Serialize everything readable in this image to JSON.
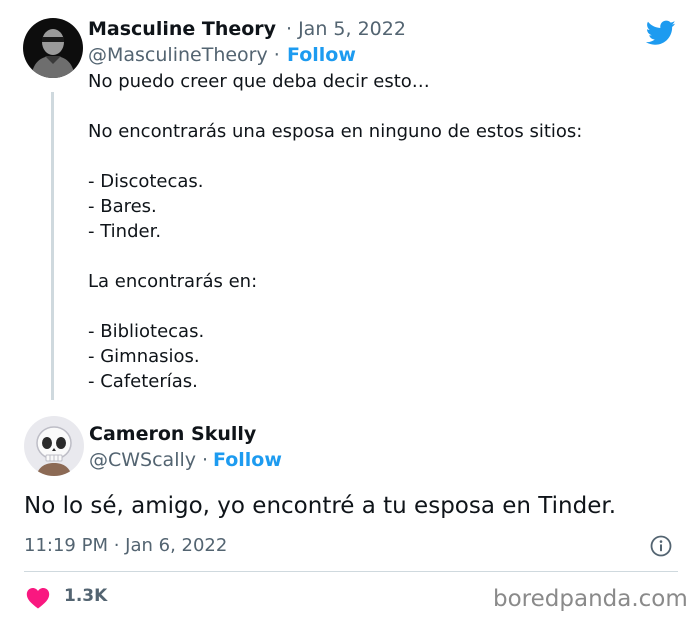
{
  "original_tweet": {
    "author_name": "Masculine Theory",
    "date": "· Jan 5, 2022",
    "handle": "@MasculineTheory ·",
    "follow_label": "Follow",
    "lines": [
      "No puedo creer que deba decir esto…",
      "No encontrarás una esposa en ninguno de estos sitios:",
      "- Discotecas.",
      "- Bares.",
      "- Tinder.",
      "La encontrarás en:",
      "- Bibliotecas.",
      "- Gimnasios.",
      "- Cafeterías."
    ]
  },
  "reply_tweet": {
    "author_name": "Cameron Skully",
    "handle": "@CWScally ·",
    "follow_label": "Follow",
    "text": "No lo sé, amigo, yo encontré a tu esposa en Tinder.",
    "timestamp": "11:19 PM · Jan 6, 2022",
    "likes": "1.3K"
  },
  "watermark": "boredpanda.com",
  "icons": {
    "brand": "twitter-bird-icon",
    "info": "info-icon",
    "like": "heart-icon"
  },
  "colors": {
    "accent": "#1d9bf0",
    "like": "#f91880",
    "secondary_text": "#536471"
  }
}
